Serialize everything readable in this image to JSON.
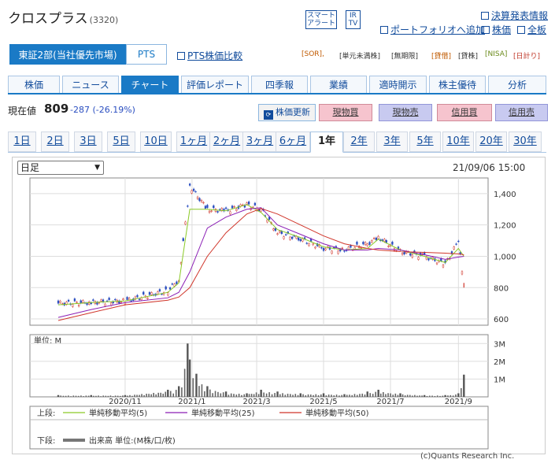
{
  "header": {
    "title": "クロスプラス",
    "code": "(3320)"
  },
  "small_buttons": [
    "スマート",
    "アラート",
    "IR",
    "TV"
  ],
  "top_links": [
    "決算発表情報",
    "ポートフォリオへ追加",
    "株価",
    "全板"
  ],
  "market": {
    "selected": "東証2部(当社優先市場)",
    "pts": "PTS",
    "compare": "PTS株価比較"
  },
  "tags": [
    "[SOR],",
    "[単元未満株]",
    "[無期限]",
    "[貸借]",
    "[貸株]",
    "[NISA]",
    "[日計り]"
  ],
  "nav_tabs": [
    "株価",
    "ニュース",
    "チャート",
    "評価レポート",
    "四季報",
    "業績",
    "適時開示",
    "株主優待",
    "分析"
  ],
  "price": {
    "label": "現在値",
    "value": "809",
    "change": "-287 (-26.19%)"
  },
  "actions": {
    "refresh": "株価更新",
    "cash_buy": "現物買",
    "cash_sell": "現物売",
    "margin_buy": "信用買",
    "margin_sell": "信用売"
  },
  "ranges": [
    "1日",
    "2日",
    "3日",
    "5日",
    "10日",
    "1ヶ月",
    "2ヶ月",
    "3ヶ月",
    "6ヶ月",
    "1年",
    "2年",
    "3年",
    "5年",
    "10年",
    "20年",
    "30年"
  ],
  "active_range": "1年",
  "period_select": "日足",
  "timestamp": "21/09/06 15:00",
  "colors": {
    "accent": "#1a7ac6",
    "ma5": "#8ac926",
    "ma25": "#8b1fb5",
    "ma50": "#d0352a",
    "up": "#d0352a",
    "down": "#2a4ec0"
  },
  "legend": {
    "upper_label": "上段:",
    "lower_label": "下段:",
    "items": [
      "単純移動平均(5)",
      "単純移動平均(25)",
      "単純移動平均(50)"
    ],
    "volume": "出来高 単位:(M株/口/枚)"
  },
  "copyright": "(c)Quants Research Inc.",
  "chart_data": [
    {
      "type": "line",
      "title": "",
      "x_ticks": [
        "2020/11",
        "2021/1",
        "2021/3",
        "2021/5",
        "2021/7",
        "2021/9"
      ],
      "y_ticks": [
        "600",
        "800",
        "1,000",
        "1,200",
        "1,400"
      ],
      "ylim": [
        560,
        1500
      ],
      "x": [
        "2020/09",
        "2020/10",
        "2020/11",
        "2020/12/10",
        "2020/12/20",
        "2020/12/30",
        "2021/01/15",
        "2021/02/01",
        "2021/02/20",
        "2021/03/05",
        "2021/03/20",
        "2021/04/10",
        "2021/05/01",
        "2021/05/20",
        "2021/06/10",
        "2021/06/20",
        "2021/07/10",
        "2021/08/01",
        "2021/08/20",
        "2021/09/01",
        "2021/09/06"
      ],
      "series": [
        {
          "name": "単純移動平均(5)",
          "values": [
            690,
            705,
            715,
            770,
            830,
            1300,
            1300,
            1290,
            1330,
            1280,
            1170,
            1120,
            1060,
            1040,
            1050,
            1110,
            1040,
            1000,
            960,
            1050,
            1000
          ]
        },
        {
          "name": "単純移動平均(25)",
          "values": [
            610,
            660,
            705,
            735,
            770,
            900,
            1180,
            1250,
            1300,
            1310,
            1200,
            1140,
            1080,
            1040,
            1040,
            1050,
            1040,
            1010,
            980,
            995,
            1000
          ]
        },
        {
          "name": "単純移動平均(50)",
          "values": [
            590,
            640,
            690,
            720,
            740,
            800,
            1000,
            1150,
            1270,
            1305,
            1270,
            1200,
            1130,
            1080,
            1050,
            1040,
            1030,
            1025,
            1020,
            1015,
            1010
          ]
        },
        {
          "name": "close",
          "values": [
            700,
            705,
            715,
            780,
            850,
            1450,
            1300,
            1290,
            1330,
            1300,
            1150,
            1110,
            1050,
            1040,
            1080,
            1120,
            1030,
            1000,
            950,
            1096,
            809
          ]
        }
      ]
    },
    {
      "type": "bar",
      "title": "",
      "unit": "単位: M",
      "y_ticks": [
        "1M",
        "2M",
        "3M"
      ],
      "ylim": [
        0,
        3.5
      ],
      "x": [
        "2020/09",
        "2020/10",
        "2020/11",
        "2020/12/10",
        "2020/12/20",
        "2020/12/28",
        "2020/12/30",
        "2021/01/05",
        "2021/01/15",
        "2021/02/01",
        "2021/02/20",
        "2021/03/05",
        "2021/03/20",
        "2021/04/10",
        "2021/05/01",
        "2021/05/20",
        "2021/06/10",
        "2021/06/20",
        "2021/07/10",
        "2021/08/01",
        "2021/08/20",
        "2021/09/01",
        "2021/09/06"
      ],
      "values": [
        0.1,
        0.1,
        0.1,
        0.4,
        0.6,
        3.0,
        2.1,
        1.3,
        0.6,
        0.3,
        0.2,
        0.4,
        0.3,
        0.2,
        0.2,
        0.15,
        0.3,
        0.4,
        0.2,
        0.1,
        0.1,
        0.2,
        1.25
      ]
    }
  ]
}
